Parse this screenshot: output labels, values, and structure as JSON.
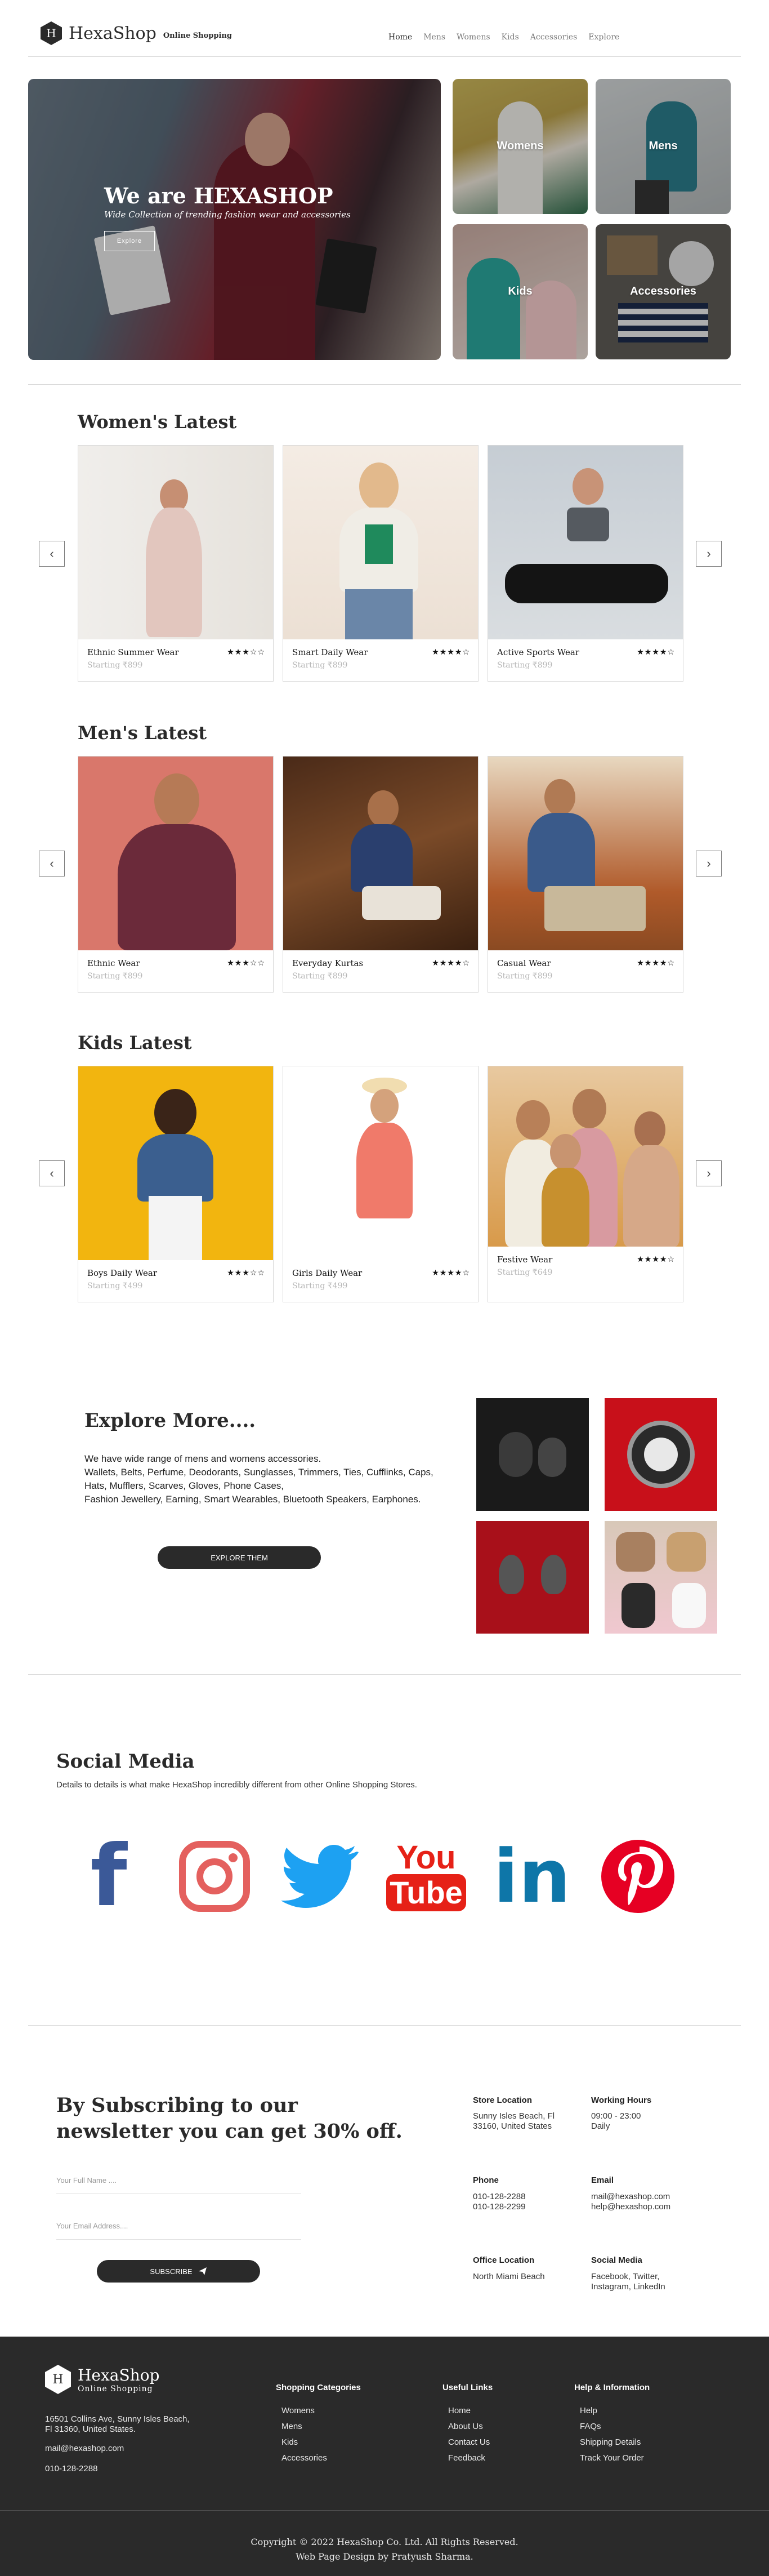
{
  "brand": {
    "initial": "H",
    "name": "HexaShop",
    "tagline": "Online Shopping"
  },
  "nav": [
    "Home",
    "Mens",
    "Womens",
    "Kids",
    "Accessories",
    "Explore"
  ],
  "hero": {
    "title": "We are HEXASHOP",
    "subtitle": "Wide Collection of trending fashion wear and accessories",
    "button": "Explore",
    "tiles": [
      "Womens",
      "Mens",
      "Kids",
      "Accessories"
    ]
  },
  "sections": [
    {
      "title": "Women's Latest",
      "products": [
        {
          "name": "Ethnic Summer Wear",
          "price": "Starting ₹899",
          "stars": "★★★☆☆"
        },
        {
          "name": "Smart Daily Wear",
          "price": "Starting ₹899",
          "stars": "★★★★☆"
        },
        {
          "name": "Active Sports Wear",
          "price": "Starting ₹899",
          "stars": "★★★★☆"
        }
      ]
    },
    {
      "title": "Men's Latest",
      "products": [
        {
          "name": "Ethnic Wear",
          "price": "Starting ₹899",
          "stars": "★★★☆☆"
        },
        {
          "name": "Everyday Kurtas",
          "price": "Starting ₹899",
          "stars": "★★★★☆"
        },
        {
          "name": "Casual Wear",
          "price": "Starting ₹899",
          "stars": "★★★★☆"
        }
      ]
    },
    {
      "title": "Kids Latest",
      "products": [
        {
          "name": "Boys Daily Wear",
          "price": "Starting ₹499",
          "stars": "★★★☆☆"
        },
        {
          "name": "Girls Daily Wear",
          "price": "Starting ₹499",
          "stars": "★★★★☆"
        },
        {
          "name": "Festive Wear",
          "price": "Starting ₹649",
          "stars": "★★★★☆"
        }
      ]
    }
  ],
  "arrows": {
    "prev": "‹",
    "next": "›"
  },
  "explore": {
    "title": "Explore More....",
    "line1": "We have wide range of mens and womens accessories.",
    "line2": "Wallets, Belts, Perfume, Deodorants, Sunglasses, Trimmers, Ties, Cufflinks, Caps, Hats, Mufflers, Scarves, Gloves, Phone Cases,",
    "line3": "Fashion Jewellery, Earning, Smart Wearables, Bluetooth Speakers, Earphones.",
    "button": "EXPLORE THEM"
  },
  "social": {
    "title": "Social Media",
    "subtitle": "Details to details is what make HexaShop incredibly different from other Online Shopping Stores.",
    "icons": [
      "facebook-icon",
      "instagram-icon",
      "twitter-icon",
      "youtube-icon",
      "linkedin-icon",
      "pinterest-icon"
    ],
    "youtube_you": "You",
    "youtube_tube": "Tube",
    "linkedin_text": "in",
    "facebook_text": "f"
  },
  "newsletter": {
    "title": "By Subscribing to our newsletter you can get 30% off.",
    "name_placeholder": "Your Full Name ....",
    "email_placeholder": "Your Email Address....",
    "button": "SUBSCRIBE"
  },
  "contact": {
    "store_h": "Store Location",
    "store_v1": "Sunny Isles Beach, Fl",
    "store_v2": "33160, United States",
    "hours_h": "Working Hours",
    "hours_v1": "09:00 - 23:00",
    "hours_v2": "Daily",
    "phone_h": "Phone",
    "phone_v1": "010-128-2288",
    "phone_v2": "010-128-2299",
    "email_h": "Email",
    "email_v1": "mail@hexashop.com",
    "email_v2": "help@hexashop.com",
    "office_h": "Office Location",
    "office_v1": "North Miami Beach",
    "social_h": "Social Media",
    "social_v1": "Facebook, Twitter,",
    "social_v2": "Instagram, LinkedIn"
  },
  "footer": {
    "address1": "16501 Collins Ave, Sunny Isles Beach,",
    "address2": "Fl 31360, United States.",
    "email": "mail@hexashop.com",
    "phone": "010-128-2288",
    "col1_h": "Shopping Categories",
    "col1": [
      "Womens",
      "Mens",
      "Kids",
      "Accessories"
    ],
    "col2_h": "Useful Links",
    "col2": [
      "Home",
      "About Us",
      "Contact Us",
      "Feedback"
    ],
    "col3_h": "Help & Information",
    "col3": [
      "Help",
      "FAQs",
      "Shipping Details",
      "Track Your Order"
    ],
    "copyright": "Copyright © 2022 HexaShop Co. Ltd. All Rights Reserved.",
    "credit": "Web Page Design by Pratyush Sharma."
  },
  "colors": {
    "dark": "#2a2a2a",
    "facebook": "#3b5998",
    "instagram": "#e4605e",
    "twitter": "#1da1f2",
    "youtube": "#e62117",
    "linkedin": "#0e76a8",
    "pinterest": "#e60023"
  }
}
